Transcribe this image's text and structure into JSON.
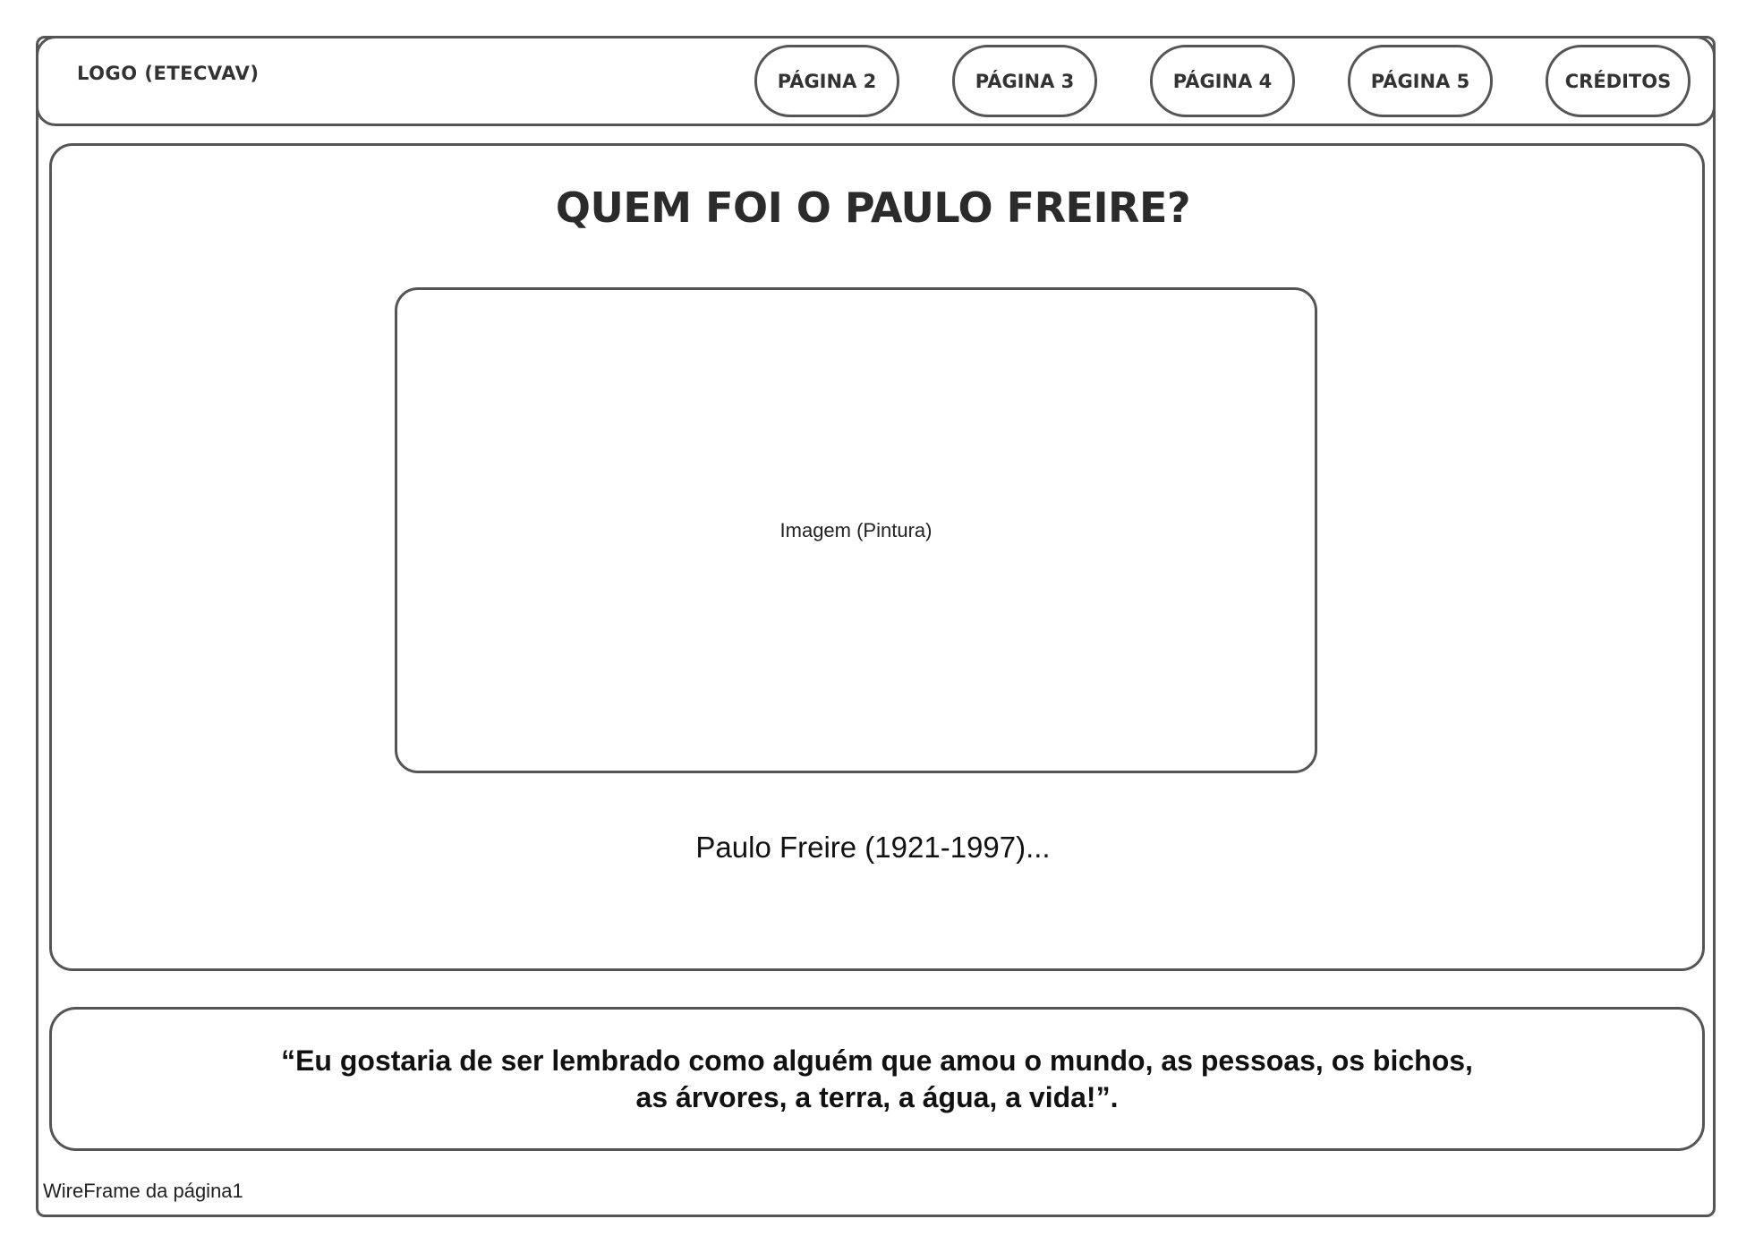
{
  "header": {
    "logo": "LOGO (ETECVAV)",
    "nav": [
      {
        "label": "PÁGINA 2"
      },
      {
        "label": "PÁGINA 3"
      },
      {
        "label": "PÁGINA 4"
      },
      {
        "label": "PÁGINA 5"
      },
      {
        "label": "CRÉDITOS"
      }
    ]
  },
  "main": {
    "title": "QUEM FOI O PAULO FREIRE?",
    "image_label": "Imagem (Pintura)",
    "caption": "Paulo Freire (1921-1997)..."
  },
  "quote": {
    "text": "“Eu gostaria de ser lembrado como alguém que amou o mundo, as pessoas, os bichos, as árvores, a terra, a água, a vida!”."
  },
  "footer": {
    "label": "WireFrame da página1"
  }
}
